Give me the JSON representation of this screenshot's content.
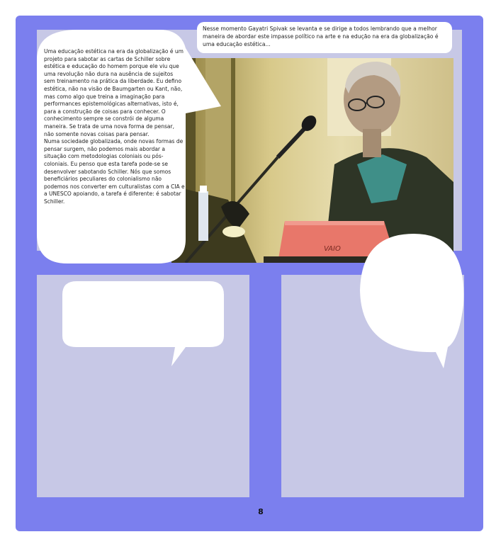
{
  "caption": {
    "text": "Nesse momento Gayatri Spivak se levanta e se dirige a todos lembrando que a melhor maneira de abordar este impasse político na arte e na edução na era da globalização é uma educação estética..."
  },
  "speech": {
    "paragraph_1": "Uma educação estética na era da globalização é um projeto para sabotar as cartas de Schiller sobre estética e educação do homem porque ele viu que uma revolução não dura na ausência de sujeitos sem treinamento na prática da liberdade. Eu defino estética, não na visão de Baumgarten ou Kant, não, mas como algo que treina a imaginação para performances epistemológicas alternativas, isto é, para a construção de coisas para conhecer. O conhecimento sempre se constrói de alguma maneira. Se trata de uma nova forma de pensar, não somente novas coisas para pensar.",
    "paragraph_2": "Numa sociedade globalizada, onde novas formas de pensar surgem, não podemos mais abordar a situação com metodologias coloniais ou pós-coloniais. Eu penso que esta tarefa pode-se se desenvolver sabotando Schiller. Nós que somos beneficiários peculiares do colonialismo não podemos nos converter em culturalistas com a CIA e a UNESCO apoiando, a tarefa é diferente: é sabotar Schiller."
  },
  "photo": {
    "laptop_brand": "VAIO"
  },
  "page_number": "8",
  "colors": {
    "page_background": "#7b7fee",
    "panel_fill": "#c7c8e6",
    "balloon_fill": "#ffffff",
    "laptop": "#e8776a"
  }
}
